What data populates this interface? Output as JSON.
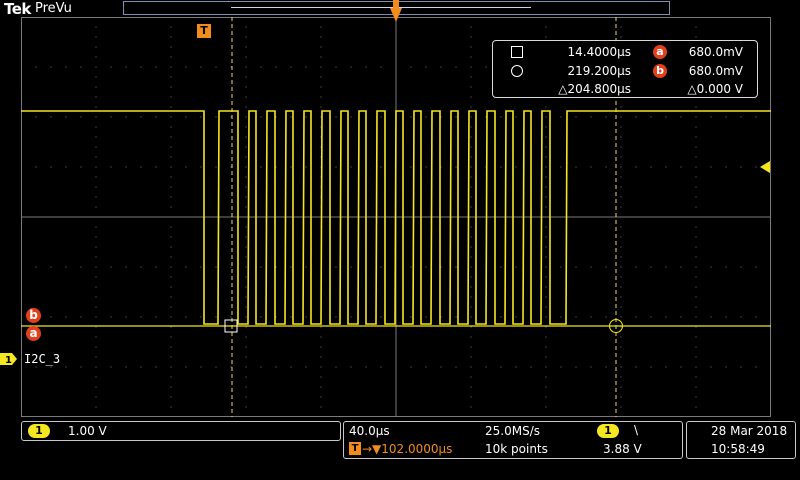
{
  "header": {
    "brand": "Tek",
    "mode": "PreVu"
  },
  "trigger": {
    "marker": "T",
    "position_icon": "trigger-position-icon",
    "level_icon": "trigger-level-arrow-icon"
  },
  "readout": {
    "cursor1_icon": "square-cursor-icon",
    "cursor1_time": "14.4000µs",
    "cursor1_badge": "a",
    "cursor1_volt": "680.0mV",
    "cursor2_icon": "circle-cursor-icon",
    "cursor2_time": "219.200µs",
    "cursor2_badge": "b",
    "cursor2_volt": "680.0mV",
    "delta_time": "△204.800µs",
    "delta_volt": "△0.000 V"
  },
  "markers": {
    "a": "a",
    "b": "b"
  },
  "channel": {
    "number": "1",
    "label": "I2C_3",
    "color": "#f4e620"
  },
  "bottom": {
    "ch1_number": "1",
    "ch1_scale": "1.00 V",
    "time_per_div": "40.0µs",
    "sample_rate": "25.0MS/s",
    "trig_chip": "1",
    "trig_slope": "\\",
    "trig_pos_icon": "T",
    "trig_delay": "→▼102.0000µs",
    "record_length": "10k points",
    "trig_level": "3.88 V",
    "date": "28 Mar  2018",
    "time": "10:58:49"
  }
}
